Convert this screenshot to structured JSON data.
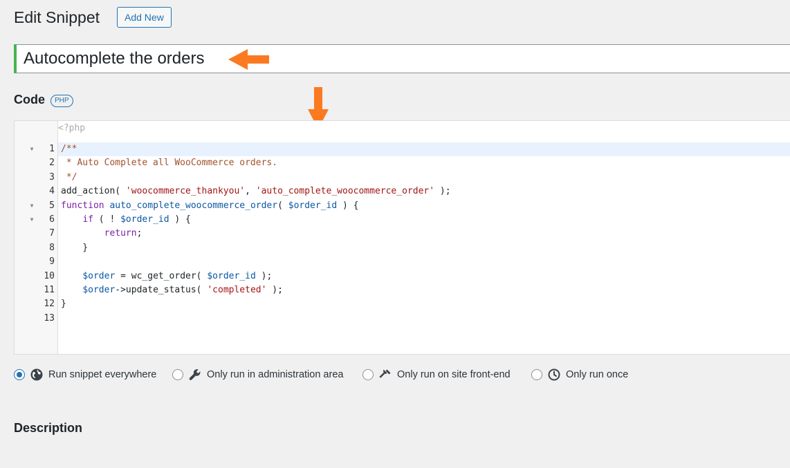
{
  "header": {
    "title": "Edit Snippet",
    "add_new_label": "Add New"
  },
  "snippet": {
    "title_value": "Autocomplete the orders"
  },
  "annotations": {
    "arrow_color": "#fb7a21"
  },
  "code_section": {
    "label": "Code",
    "language_badge": "PHP",
    "preamble": "<?php",
    "lines": [
      {
        "n": "1",
        "fold": true,
        "active": true,
        "tokens": [
          [
            "c",
            "/**"
          ]
        ]
      },
      {
        "n": "2",
        "fold": false,
        "tokens": [
          [
            "c",
            " * Auto Complete all WooCommerce orders."
          ]
        ]
      },
      {
        "n": "3",
        "fold": false,
        "tokens": [
          [
            "c",
            " */"
          ]
        ]
      },
      {
        "n": "4",
        "fold": false,
        "tokens": [
          [
            "p",
            "add_action( "
          ],
          [
            "s",
            "'woocommerce_thankyou'"
          ],
          [
            "p",
            ", "
          ],
          [
            "s",
            "'auto_complete_woocommerce_order'"
          ],
          [
            "p",
            " );"
          ]
        ]
      },
      {
        "n": "5",
        "fold": true,
        "tokens": [
          [
            "k",
            "function"
          ],
          [
            "p",
            " "
          ],
          [
            "d",
            "auto_complete_woocommerce_order"
          ],
          [
            "p",
            "( "
          ],
          [
            "v",
            "$order_id"
          ],
          [
            "p",
            " ) {"
          ]
        ]
      },
      {
        "n": "6",
        "fold": true,
        "tokens": [
          [
            "p",
            "    "
          ],
          [
            "k",
            "if"
          ],
          [
            "p",
            " ( ! "
          ],
          [
            "v",
            "$order_id"
          ],
          [
            "p",
            " ) {"
          ]
        ]
      },
      {
        "n": "7",
        "fold": false,
        "tokens": [
          [
            "p",
            "        "
          ],
          [
            "k",
            "return"
          ],
          [
            "p",
            ";"
          ]
        ]
      },
      {
        "n": "8",
        "fold": false,
        "tokens": [
          [
            "p",
            "    }"
          ]
        ]
      },
      {
        "n": "9",
        "fold": false,
        "tokens": []
      },
      {
        "n": "10",
        "fold": false,
        "tokens": [
          [
            "p",
            "    "
          ],
          [
            "v",
            "$order"
          ],
          [
            "p",
            " = wc_get_order( "
          ],
          [
            "v",
            "$order_id"
          ],
          [
            "p",
            " );"
          ]
        ]
      },
      {
        "n": "11",
        "fold": false,
        "tokens": [
          [
            "p",
            "    "
          ],
          [
            "v",
            "$order"
          ],
          [
            "p",
            "->update_status( "
          ],
          [
            "s",
            "'completed'"
          ],
          [
            "p",
            " );"
          ]
        ]
      },
      {
        "n": "12",
        "fold": false,
        "tokens": [
          [
            "p",
            "}"
          ]
        ]
      },
      {
        "n": "13",
        "fold": false,
        "tokens": []
      }
    ],
    "fold_marker": "▼"
  },
  "scope": {
    "options": [
      {
        "label": "Run snippet everywhere",
        "icon": "globe-icon",
        "checked": true
      },
      {
        "label": "Only run in administration area",
        "icon": "wrench-icon",
        "checked": false
      },
      {
        "label": "Only run on site front-end",
        "icon": "hammer-icon",
        "checked": false
      },
      {
        "label": "Only run once",
        "icon": "clock-icon",
        "checked": false
      }
    ]
  },
  "description_section": {
    "label": "Description"
  }
}
